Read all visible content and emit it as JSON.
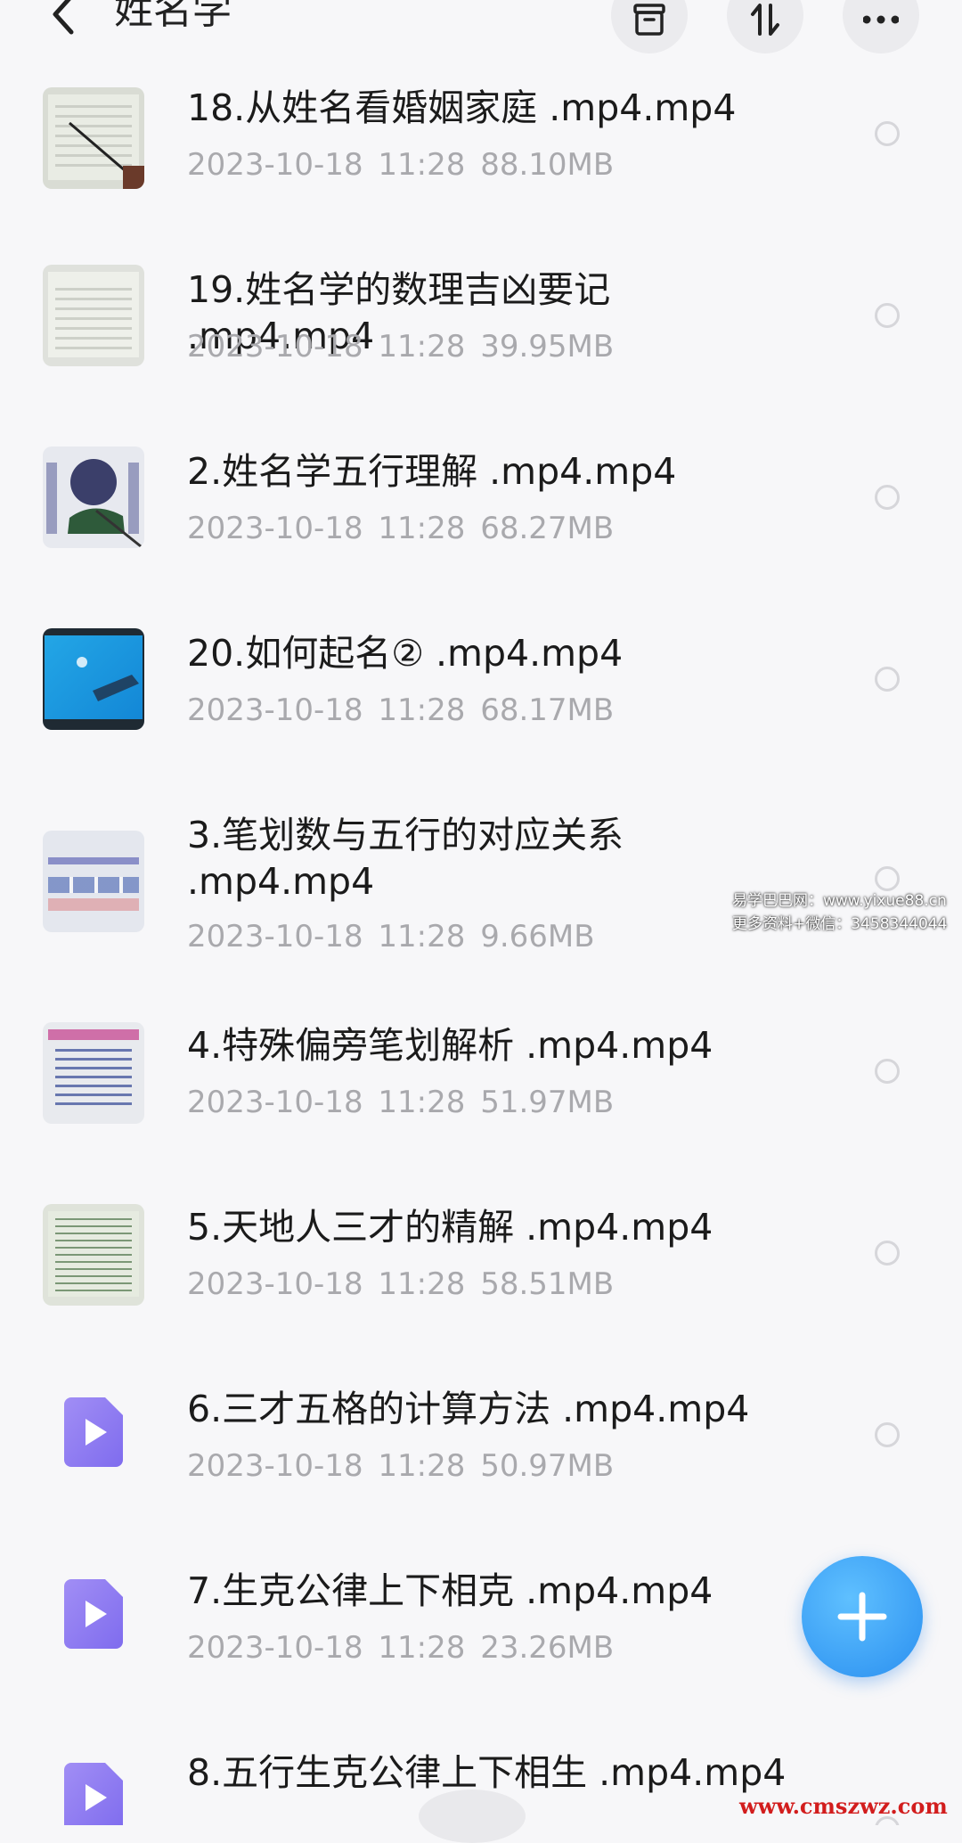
{
  "header": {
    "title": "姓名学"
  },
  "files": [
    {
      "name": "18.从姓名看婚姻家庭 .mp4.mp4",
      "date": "2023-10-18",
      "time": "11:28",
      "size": "88.10MB",
      "thumb": "doc-pointer"
    },
    {
      "name": "19.姓名学的数理吉凶要记 .mp4.mp4",
      "date": "2023-10-18",
      "time": "11:28",
      "size": "39.95MB",
      "thumb": "doc"
    },
    {
      "name": "2.姓名学五行理解 .mp4.mp4",
      "date": "2023-10-18",
      "time": "11:28",
      "size": "68.27MB",
      "thumb": "cover"
    },
    {
      "name": "20.如何起名② .mp4.mp4",
      "date": "2023-10-18",
      "time": "11:28",
      "size": "68.17MB",
      "thumb": "screen"
    },
    {
      "name": "3.笔划数与五行的对应关系 .mp4.mp4",
      "date": "2023-10-18",
      "time": "11:28",
      "size": "9.66MB",
      "thumb": "table"
    },
    {
      "name": "4.特殊偏旁笔划解析 .mp4.mp4",
      "date": "2023-10-18",
      "time": "11:28",
      "size": "51.97MB",
      "thumb": "doc-red"
    },
    {
      "name": "5.天地人三才的精解 .mp4.mp4",
      "date": "2023-10-18",
      "time": "11:28",
      "size": "58.51MB",
      "thumb": "doc-green"
    },
    {
      "name": "6.三才五格的计算方法 .mp4.mp4",
      "date": "2023-10-18",
      "time": "11:28",
      "size": "50.97MB",
      "thumb": "video-icon"
    },
    {
      "name": "7.生克公律上下相克 .mp4.mp4",
      "date": "2023-10-18",
      "time": "11:28",
      "size": "23.26MB",
      "thumb": "video-icon"
    },
    {
      "name": "8.五行生克公律上下相生 .mp4.mp4",
      "date": "",
      "time": "",
      "size": "",
      "thumb": "video-icon"
    }
  ],
  "watermark": {
    "line1": "易学巴巴网：www.yixue88.cn",
    "line2": "更多资料+微信：3458344044",
    "site": "www.cmszwz.com"
  },
  "icons": {
    "back": "chevron-left-icon",
    "archive": "archive-icon",
    "sort": "sort-icon",
    "more": "more-icon",
    "add": "plus-icon"
  },
  "colors": {
    "accent": "#2a8ff0",
    "video_icon": "#8f7cf2"
  }
}
